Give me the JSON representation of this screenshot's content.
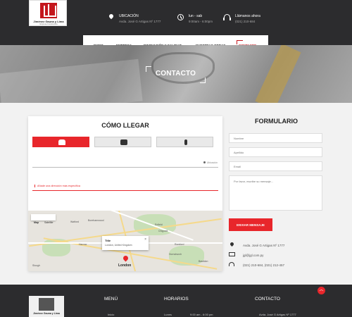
{
  "header": {
    "logo": {
      "name": "Jiménez Gauna y Lima",
      "tagline": "Empresa Constructora"
    },
    "location": {
      "label": "UBICACIÓN",
      "value": "Avda. José G Artigas Nº 1777"
    },
    "hours": {
      "label": "lun - sab",
      "value": "9:00am - 6:00pm"
    },
    "phone": {
      "label": "Llámanos ahora",
      "value": "(021) 210-684"
    }
  },
  "nav": {
    "items": [
      "INICIO",
      "EMPRESA",
      "INNOVACIÓN Y CALIDAD",
      "NUESTRAS OBRAS",
      "CONTACTO"
    ],
    "active": "CONTACTO"
  },
  "hero": {
    "title": "CONTACTO"
  },
  "directions": {
    "title": "CÓMO LLEGAR",
    "modes": [
      "car-icon",
      "bus-icon",
      "walking-icon"
    ],
    "active_mode": "car",
    "address_label": "Ubicación",
    "hint": "Añade una dirección más específica",
    "map": {
      "type_options": [
        "Map",
        "Satellite"
      ],
      "selected_type": "Map",
      "info_title": "Title",
      "info_subtitle": "London, United Kingdom",
      "places": [
        "Watford",
        "Borehamwood",
        "Enfield",
        "Chigwell",
        "Harrow",
        "Romford",
        "Slough",
        "London",
        "Hornchurch",
        "Basildon"
      ]
    }
  },
  "form": {
    "title": "FORMULARIO",
    "name_placeholder": "Nombre",
    "lastname_placeholder": "Apellido",
    "email_placeholder": "Email",
    "message_placeholder": "Por favor, escribe su mensaje...",
    "submit_label": "ENVIAR MENSAJE"
  },
  "contact": {
    "address": "Avda. José G Artigas Nº 1777",
    "email": "jgl@jgl.com.py",
    "phones": "(021) 210-684, (021) 212-457"
  },
  "footer": {
    "logo_name": "Jiménez Gauna y Lima",
    "menu_title": "MENÚ",
    "menu_first": "Inicio",
    "hours_title": "HORARIOS",
    "hours_day": "Lunes",
    "hours_time": "9:00 am - 6:00 pm",
    "contact_title": "CONTACTO",
    "contact_address": "Avda. José G Artigas Nº 1777"
  },
  "colors": {
    "accent": "#e8262b",
    "dark": "#2c2c2e"
  }
}
